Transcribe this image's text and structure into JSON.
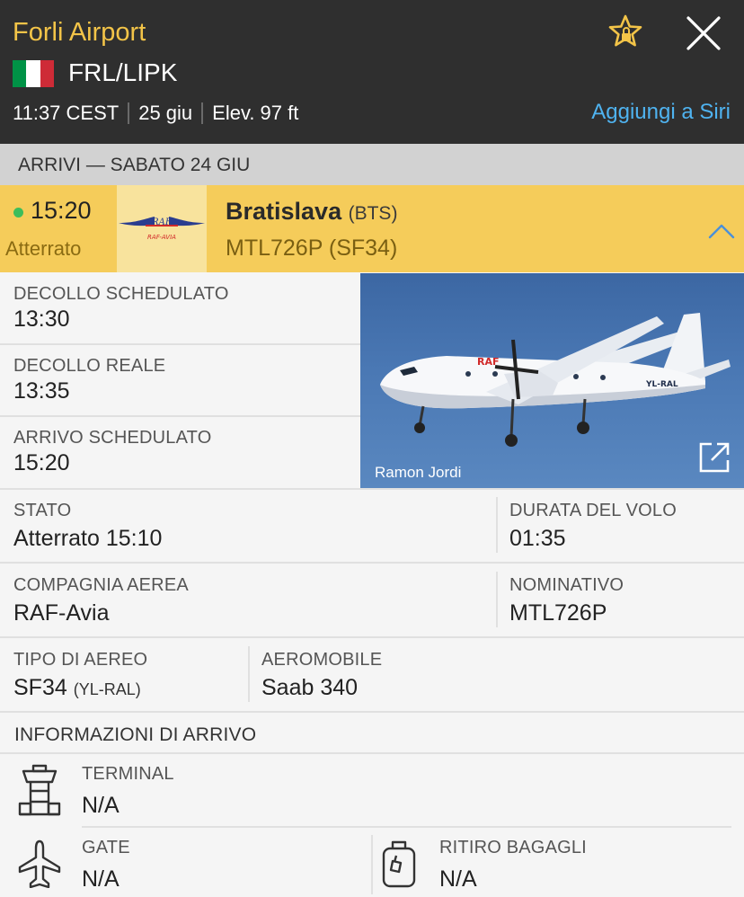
{
  "header": {
    "airport_name": "Forli Airport",
    "code": "FRL/LIPK",
    "time": "11:37 CEST",
    "date": "25 giu",
    "elevation": "Elev. 97 ft",
    "siri_link": "Aggiungi a Siri",
    "flag": [
      "#009246",
      "#ffffff",
      "#ce2b37"
    ],
    "favorite_icon": "star-lock-icon",
    "close_icon": "close-icon"
  },
  "section": {
    "title": "ARRIVI — SABATO 24 GIU"
  },
  "flight": {
    "time": "15:20",
    "status": "Atterrato",
    "status_color": "#3dbd5b",
    "airline_logo_text": "RAF-AVIA",
    "destination": "Bratislava",
    "destination_code": "(BTS)",
    "flight_number": "MTL726P (SF34)"
  },
  "details": {
    "sched_departure_label": "DECOLLO SCHEDULATO",
    "sched_departure": "13:30",
    "actual_departure_label": "DECOLLO REALE",
    "actual_departure": "13:35",
    "sched_arrival_label": "ARRIVO SCHEDULATO",
    "sched_arrival": "15:20",
    "status_label": "STATO",
    "status": "Atterrato 15:10",
    "duration_label": "DURATA DEL VOLO",
    "duration": "01:35",
    "airline_label": "COMPAGNIA AEREA",
    "airline": "RAF-Avia",
    "callsign_label": "NOMINATIVO",
    "callsign": "MTL726P",
    "aircraft_type_label": "TIPO DI AEREO",
    "aircraft_type": "SF34",
    "registration": "(YL-RAL)",
    "aircraft_label": "AEROMOBILE",
    "aircraft": "Saab 340"
  },
  "photo": {
    "credit": "Ramon Jordi",
    "livery_text": "RAF",
    "tail_text": "YL-RAL"
  },
  "arrival_info": {
    "title": "INFORMAZIONI DI ARRIVO",
    "terminal_label": "TERMINAL",
    "terminal": "N/A",
    "gate_label": "GATE",
    "gate": "N/A",
    "baggage_label": "RITIRO BAGAGLI",
    "baggage": "N/A"
  }
}
